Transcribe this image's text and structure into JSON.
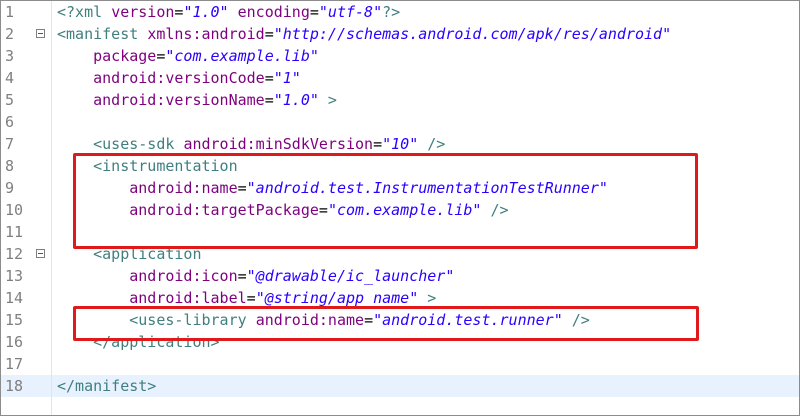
{
  "editor": {
    "lines": [
      {
        "number": "1",
        "indent": "",
        "tokens": [
          {
            "text": "<?xml ",
            "type": "tag"
          },
          {
            "text": "version",
            "type": "attr"
          },
          {
            "text": "=",
            "type": "punct"
          },
          {
            "text": "\"1.0\"",
            "type": "val"
          },
          {
            "text": " ",
            "type": "punct"
          },
          {
            "text": "encoding",
            "type": "attr"
          },
          {
            "text": "=",
            "type": "punct"
          },
          {
            "text": "\"utf-8\"",
            "type": "val"
          },
          {
            "text": "?>",
            "type": "tag"
          }
        ]
      },
      {
        "number": "2",
        "fold": true,
        "indent": "",
        "tokens": [
          {
            "text": "<manifest ",
            "type": "tag"
          },
          {
            "text": "xmlns:android",
            "type": "attr"
          },
          {
            "text": "=",
            "type": "punct"
          },
          {
            "text": "\"http://schemas.android.com/apk/res/android\"",
            "type": "val"
          }
        ]
      },
      {
        "number": "3",
        "indent": "    ",
        "tokens": [
          {
            "text": "package",
            "type": "attr"
          },
          {
            "text": "=",
            "type": "punct"
          },
          {
            "text": "\"com.example.lib\"",
            "type": "val"
          }
        ]
      },
      {
        "number": "4",
        "indent": "    ",
        "tokens": [
          {
            "text": "android:versionCode",
            "type": "attr"
          },
          {
            "text": "=",
            "type": "punct"
          },
          {
            "text": "\"1\"",
            "type": "val"
          }
        ]
      },
      {
        "number": "5",
        "indent": "    ",
        "tokens": [
          {
            "text": "android:versionName",
            "type": "attr"
          },
          {
            "text": "=",
            "type": "punct"
          },
          {
            "text": "\"1.0\"",
            "type": "val"
          },
          {
            "text": " >",
            "type": "tag"
          }
        ]
      },
      {
        "number": "6",
        "indent": "",
        "tokens": []
      },
      {
        "number": "7",
        "indent": "    ",
        "tokens": [
          {
            "text": "<uses-sdk ",
            "type": "tag"
          },
          {
            "text": "android:minSdkVersion",
            "type": "attr"
          },
          {
            "text": "=",
            "type": "punct"
          },
          {
            "text": "\"10\"",
            "type": "val"
          },
          {
            "text": " />",
            "type": "tag"
          }
        ]
      },
      {
        "number": "8",
        "indent": "    ",
        "tokens": [
          {
            "text": "<instrumentation",
            "type": "tag"
          }
        ]
      },
      {
        "number": "9",
        "indent": "        ",
        "tokens": [
          {
            "text": "android:name",
            "type": "attr"
          },
          {
            "text": "=",
            "type": "punct"
          },
          {
            "text": "\"android.test.InstrumentationTestRunner\"",
            "type": "val"
          }
        ]
      },
      {
        "number": "10",
        "indent": "        ",
        "tokens": [
          {
            "text": "android:targetPackage",
            "type": "attr"
          },
          {
            "text": "=",
            "type": "punct"
          },
          {
            "text": "\"com.example.lib\"",
            "type": "val"
          },
          {
            "text": " />",
            "type": "tag"
          }
        ]
      },
      {
        "number": "11",
        "indent": "",
        "tokens": []
      },
      {
        "number": "12",
        "fold": true,
        "indent": "    ",
        "tokens": [
          {
            "text": "<application",
            "type": "tag"
          }
        ]
      },
      {
        "number": "13",
        "indent": "        ",
        "tokens": [
          {
            "text": "android:icon",
            "type": "attr"
          },
          {
            "text": "=",
            "type": "punct"
          },
          {
            "text": "\"@drawable/ic_launcher\"",
            "type": "val"
          }
        ]
      },
      {
        "number": "14",
        "indent": "        ",
        "tokens": [
          {
            "text": "android:label",
            "type": "attr"
          },
          {
            "text": "=",
            "type": "punct"
          },
          {
            "text": "\"@string/app_name\"",
            "type": "val"
          },
          {
            "text": " >",
            "type": "tag"
          }
        ]
      },
      {
        "number": "15",
        "indent": "        ",
        "tokens": [
          {
            "text": "<uses-library ",
            "type": "tag"
          },
          {
            "text": "android:name",
            "type": "attr"
          },
          {
            "text": "=",
            "type": "punct"
          },
          {
            "text": "\"android.test.runner\"",
            "type": "val"
          },
          {
            "text": " />",
            "type": "tag"
          }
        ]
      },
      {
        "number": "16",
        "indent": "    ",
        "tokens": [
          {
            "text": "</application>",
            "type": "tag"
          }
        ]
      },
      {
        "number": "17",
        "indent": "",
        "tokens": []
      },
      {
        "number": "18",
        "current": true,
        "indent": "",
        "tokens": [
          {
            "text": "</manifest>",
            "type": "tag"
          }
        ]
      }
    ]
  },
  "colors": {
    "tag": "#3f7f7f",
    "attribute": "#7f007f",
    "value": "#2a00ff",
    "line_number": "#7f7f7f",
    "current_line": "#e8f2fe",
    "highlight_box": "#e0191a"
  },
  "icons": {
    "fold": "fold-collapse-icon"
  }
}
